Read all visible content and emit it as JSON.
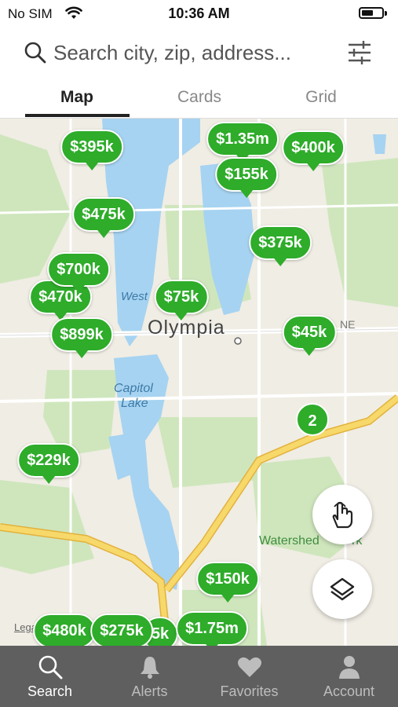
{
  "status_bar": {
    "carrier": "No SIM",
    "time": "10:36 AM"
  },
  "search": {
    "placeholder": "Search city, zip, address..."
  },
  "tabs": [
    {
      "label": "Map",
      "active": true
    },
    {
      "label": "Cards"
    },
    {
      "label": "Grid"
    }
  ],
  "map": {
    "city_label": "Olympia",
    "lake_label_1": "Capitol",
    "lake_label_2": "Lake",
    "water_label": "West",
    "park_label": "Watershed",
    "park_label_suffix": "rk",
    "road_label": "NE",
    "legal": "Legal",
    "cluster_count": "2",
    "pins": [
      "$395k",
      "$1.35m",
      "$400k",
      "$155k",
      "$475k",
      "$375k",
      "$700k",
      "$470k",
      "$75k",
      "$899k",
      "$45k",
      "$229k",
      "$150k",
      "$480k",
      "$275k",
      "$1.75m",
      "5k"
    ]
  },
  "bottom_nav": [
    {
      "label": "Search",
      "icon": "search-icon",
      "active": true
    },
    {
      "label": "Alerts",
      "icon": "bell-icon"
    },
    {
      "label": "Favorites",
      "icon": "heart-icon"
    },
    {
      "label": "Account",
      "icon": "person-icon"
    }
  ],
  "colors": {
    "accent": "#2eac2a",
    "water": "#a6d3f1",
    "park": "#cfe6bd",
    "highway": "#f3c94b",
    "tabbar": "#5f5f5f"
  }
}
